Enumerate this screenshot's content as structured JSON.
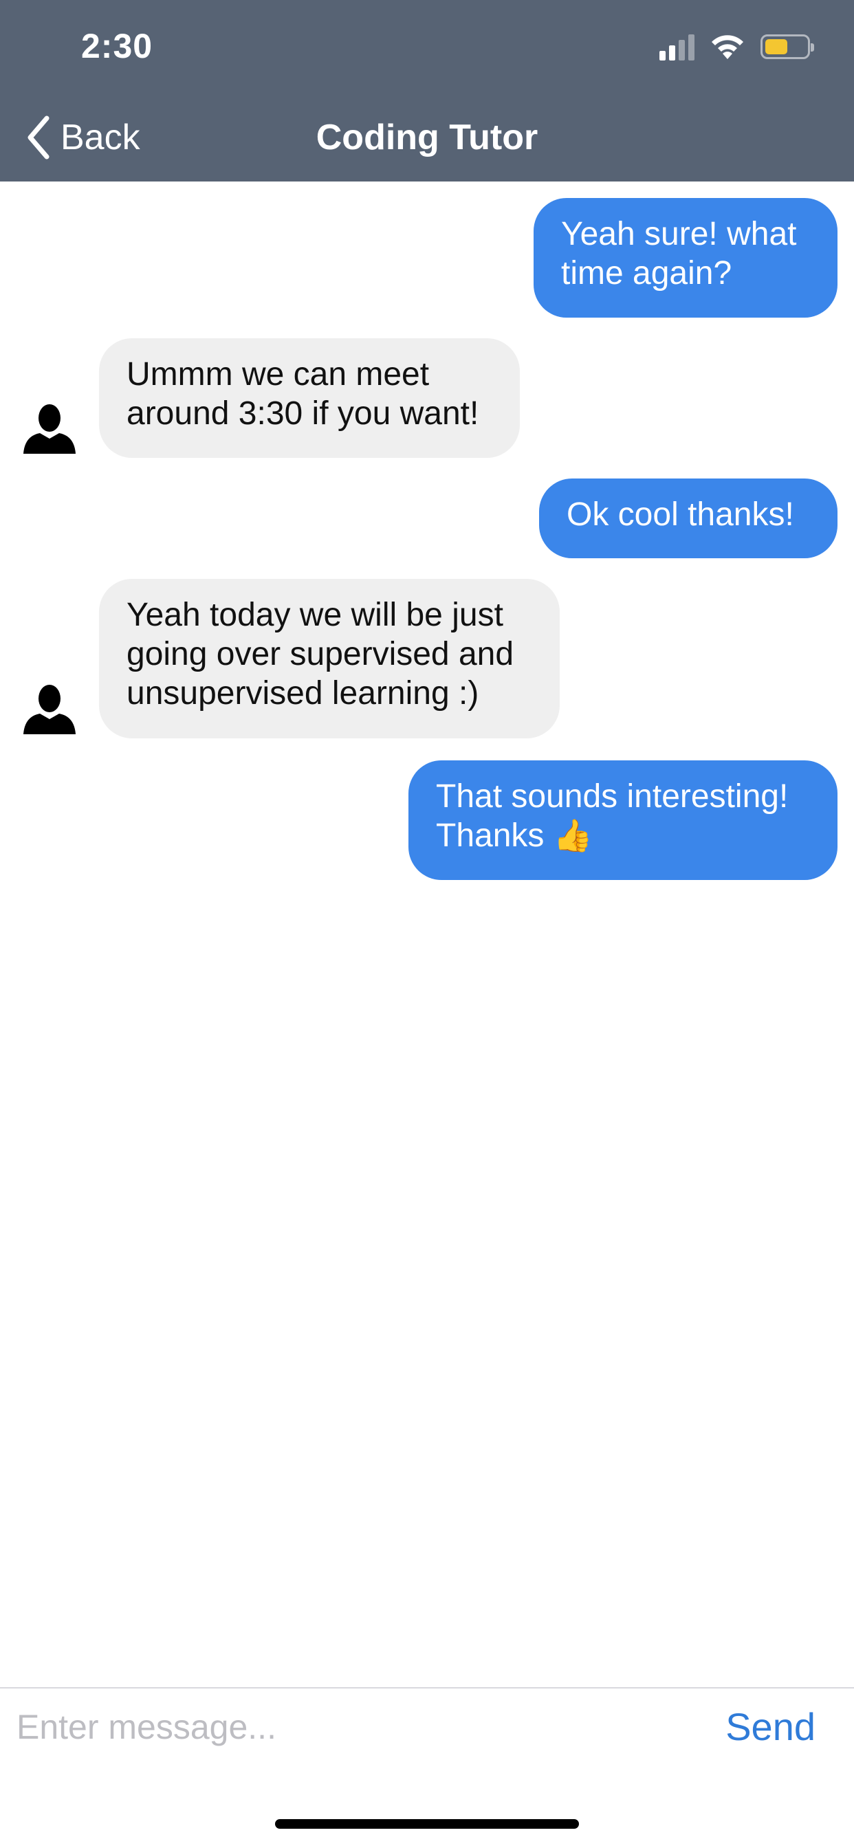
{
  "status_bar": {
    "time": "2:30",
    "icons": [
      "signal-icon",
      "wifi-icon",
      "battery-icon"
    ],
    "battery_color": "#f4c631"
  },
  "nav": {
    "back_label": "Back",
    "title": "Coding Tutor",
    "background": "#576374"
  },
  "messages": [
    {
      "sender": "me",
      "lines": [
        "Yeah sure! what",
        "time again?"
      ]
    },
    {
      "sender": "tutor",
      "lines": [
        "Ummm we can meet",
        "around 3:30 if you want!"
      ]
    },
    {
      "sender": "me",
      "lines": [
        "Ok cool thanks!"
      ]
    },
    {
      "sender": "tutor",
      "lines": [
        "Yeah today we will be just",
        "going over supervised and",
        "unsupervised learning :)"
      ]
    },
    {
      "sender": "me",
      "lines": [
        "That sounds interesting!",
        "Thanks"
      ],
      "emoji": "👍",
      "emoji_icon": "thumbs-up-icon"
    }
  ],
  "colors": {
    "sent_bubble": "#3b86ea",
    "received_bubble": "#efefef",
    "send_text": "#2f7bd8"
  },
  "composer": {
    "placeholder": "Enter message...",
    "value": "",
    "send_label": "Send"
  }
}
